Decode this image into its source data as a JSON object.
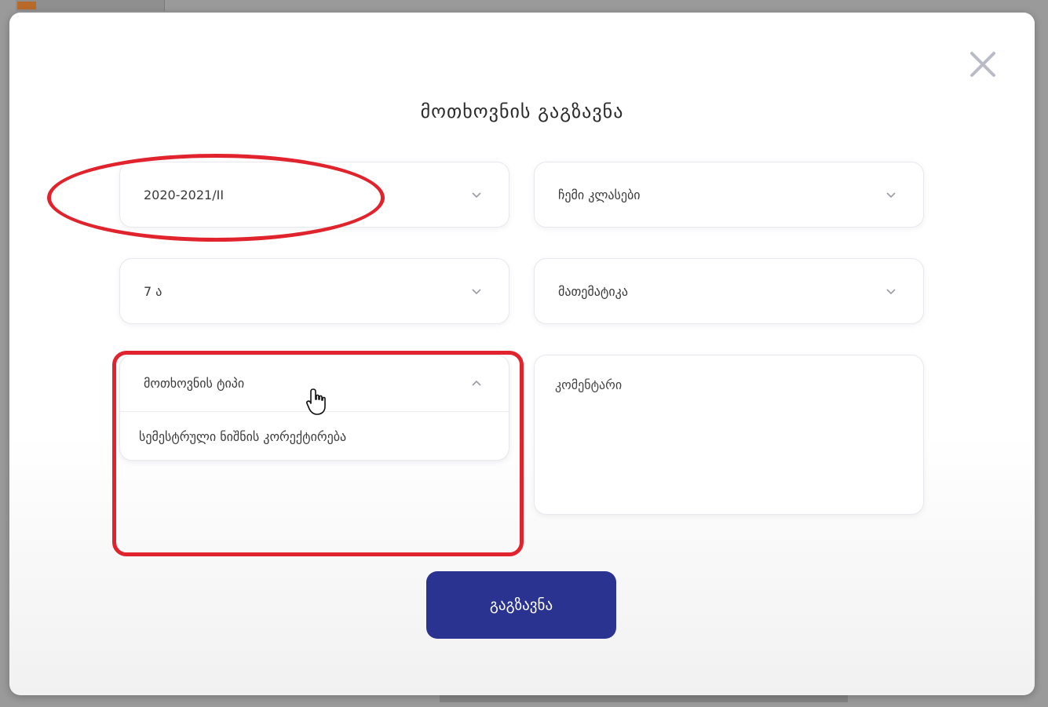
{
  "modal": {
    "title": "მოთხოვნის გაგზავნა",
    "close_icon": "close-icon"
  },
  "form": {
    "semester": {
      "value": "2020-2021/II"
    },
    "classes": {
      "value": "ჩემი კლასები"
    },
    "class_group": {
      "value": "7 ა"
    },
    "subject": {
      "value": "მათემატიკა"
    },
    "request_type": {
      "value": "მოთხოვნის ტიპი",
      "expanded": true,
      "options": [
        "სემესტრული ნიშნის კორექტირება"
      ]
    },
    "comment": {
      "placeholder": "კომენტარი"
    },
    "submit_label": "გაგზავნა"
  },
  "colors": {
    "accent": "#2b3390",
    "annotation": "#e0232c"
  }
}
